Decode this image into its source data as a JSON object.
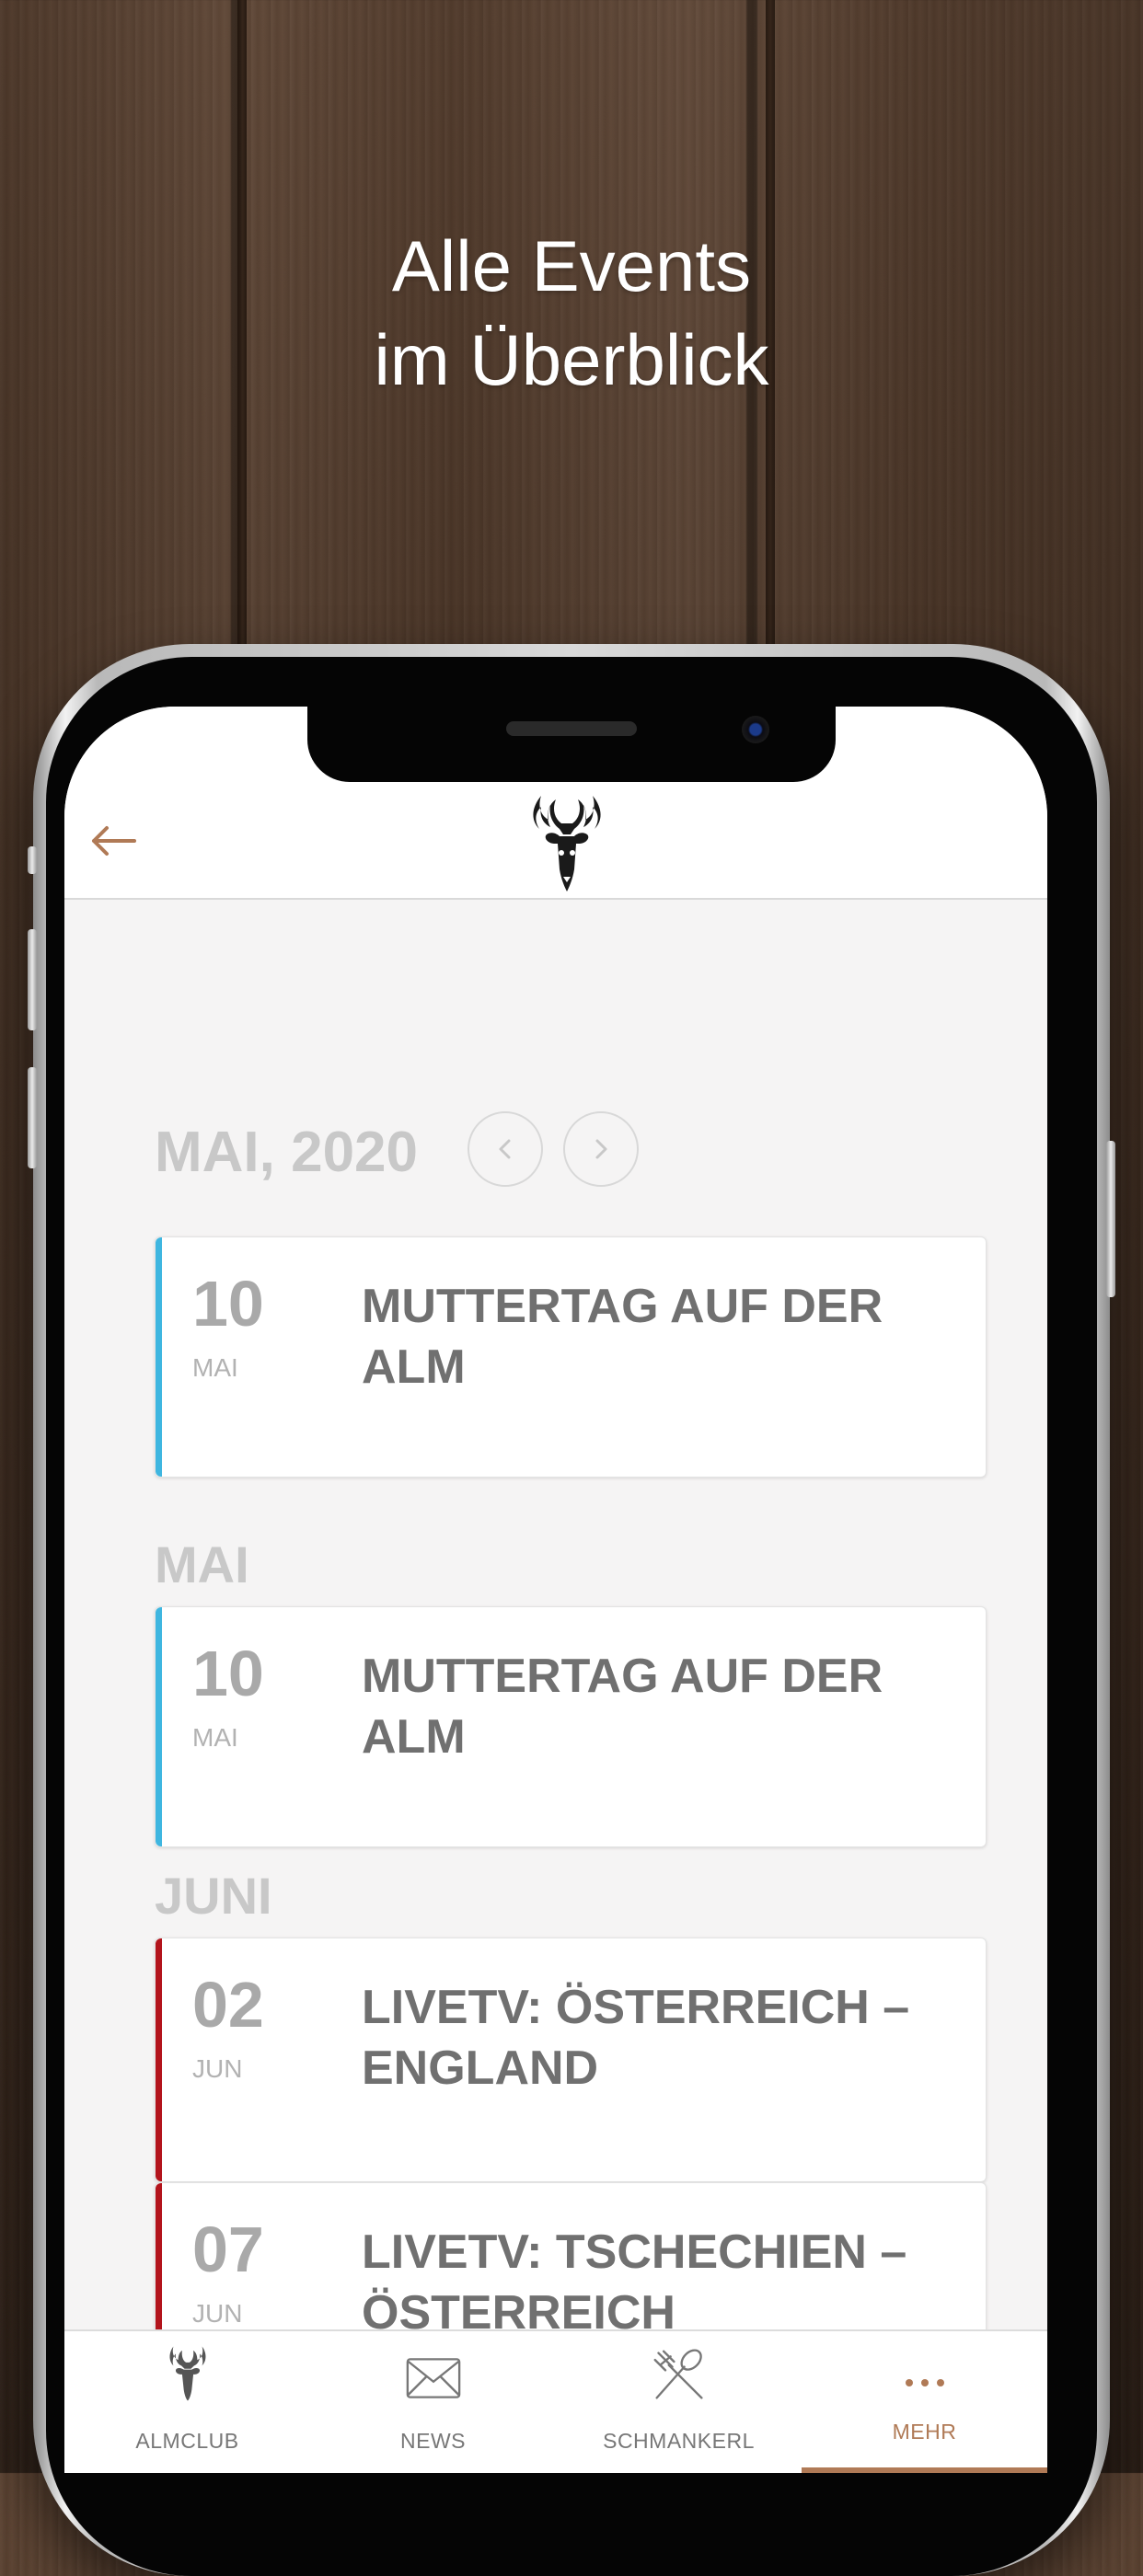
{
  "headline": {
    "line1": "Alle Events",
    "line2": "im Überblick"
  },
  "header": {
    "back_icon": "back-arrow-icon",
    "logo": "stag-head-logo"
  },
  "calendar": {
    "current_month": "MAI, 2020",
    "prev_icon": "chevron-left-icon",
    "next_icon": "chevron-right-icon"
  },
  "featured_event": {
    "day": "10",
    "month": "MAI",
    "title": "MUTTERTAG AUF DER ALM",
    "accent": "#3fb6e0"
  },
  "sections": [
    {
      "label": "MAI",
      "events": [
        {
          "day": "10",
          "month": "MAI",
          "title": "MUTTERTAG AUF DER ALM",
          "accent": "#3fb6e0"
        }
      ]
    },
    {
      "label": "JUNI",
      "events": [
        {
          "day": "02",
          "month": "JUN",
          "title": "LIVETV: ÖSTERREICH – ENGLAND",
          "accent": "#b3141c"
        },
        {
          "day": "07",
          "month": "JUN",
          "title": "LIVETV: TSCHECHIEN – ÖSTERREICH",
          "accent": "#b3141c"
        }
      ]
    }
  ],
  "tabbar": {
    "tabs": [
      {
        "label": "ALMCLUB",
        "icon": "stag-icon",
        "active": false
      },
      {
        "label": "NEWS",
        "icon": "envelope-icon",
        "active": false
      },
      {
        "label": "SCHMANKERL",
        "icon": "fork-spoon-icon",
        "active": false
      },
      {
        "label": "MEHR",
        "icon": "more-dots-icon",
        "active": true
      }
    ]
  },
  "colors": {
    "accent": "#b07a56",
    "may_accent": "#3fb6e0",
    "june_accent": "#b3141c"
  }
}
